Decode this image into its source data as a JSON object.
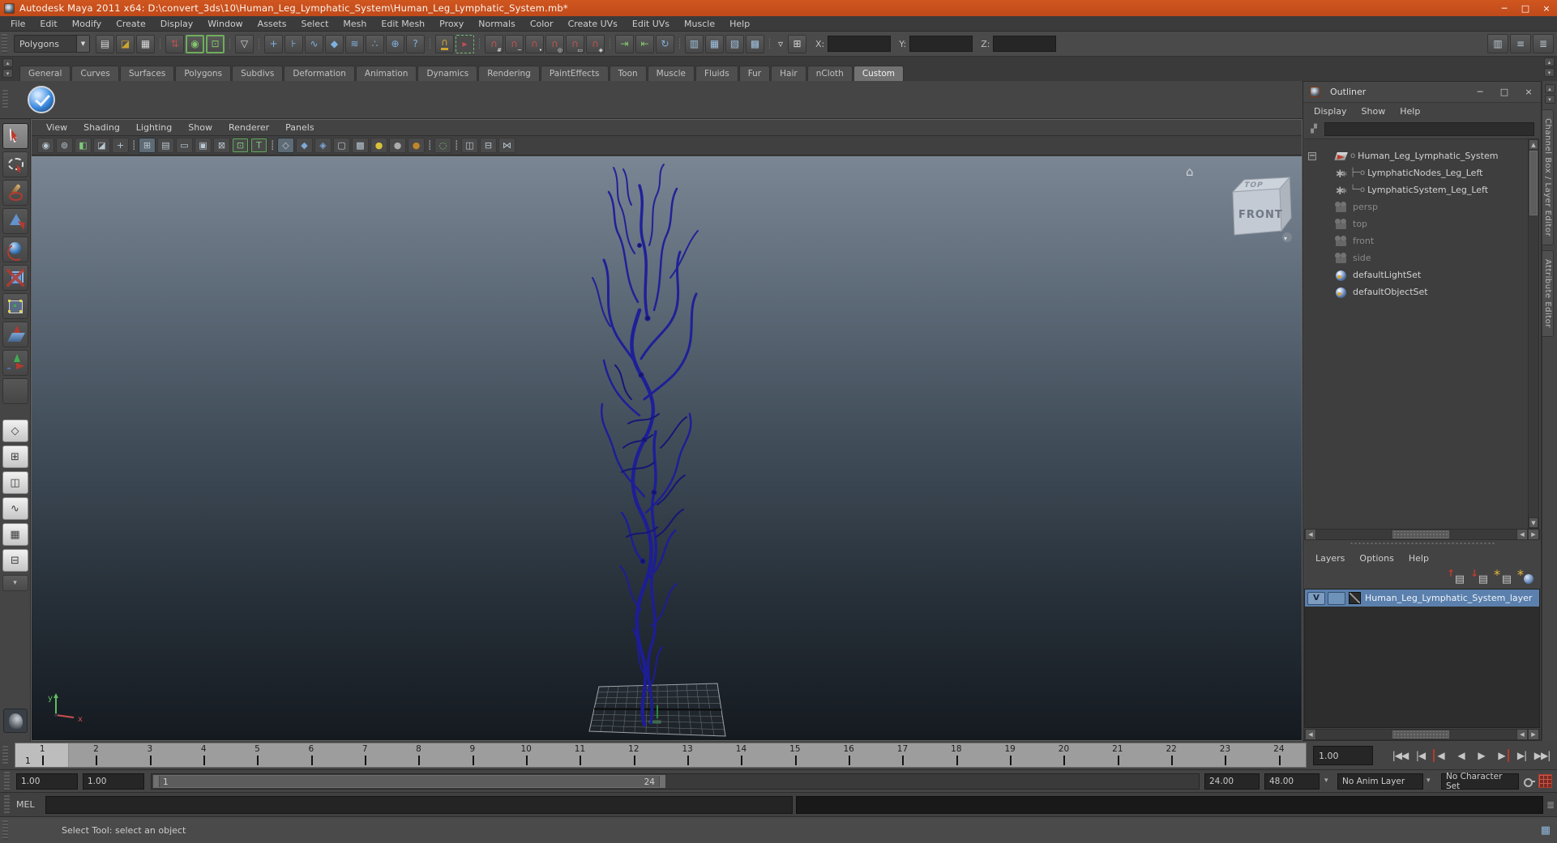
{
  "window": {
    "title": "Autodesk Maya 2011 x64: D:\\convert_3ds\\10\\Human_Leg_Lymphatic_System\\Human_Leg_Lymphatic_System.mb*",
    "buttons": [
      {
        "n": "window-minimize-button",
        "g": "─"
      },
      {
        "n": "window-maximize-button",
        "g": "□"
      },
      {
        "n": "window-close-button",
        "g": "×"
      }
    ]
  },
  "menu_bar": {
    "items": [
      "File",
      "Edit",
      "Modify",
      "Create",
      "Display",
      "Window",
      "Assets",
      "Select",
      "Mesh",
      "Edit Mesh",
      "Proxy",
      "Normals",
      "Color",
      "Create UVs",
      "Edit UVs",
      "Muscle",
      "Help"
    ]
  },
  "status_line": {
    "mode": "Polygons",
    "caret": "▼",
    "icons": [
      {
        "n": "new-scene-icon",
        "g": "▤",
        "cls": "cw"
      },
      {
        "n": "open-scene-icon",
        "g": "◪",
        "cls": "cgold"
      },
      {
        "n": "save-scene-icon",
        "g": "▦",
        "cls": "cw"
      },
      {
        "n": "separator",
        "g": "┊",
        "cls": "sep"
      },
      {
        "n": "select-by-hierarchy-icon",
        "g": "⇅",
        "cls": "cred"
      },
      {
        "n": "select-by-object-icon",
        "g": "◉",
        "cls": "cgreen on"
      },
      {
        "n": "select-by-component-icon",
        "g": "⊡",
        "cls": "cgreen on"
      },
      {
        "n": "separator",
        "g": "┊",
        "cls": "sep"
      },
      {
        "n": "selection-mask-menu-icon",
        "g": "▽",
        "cls": "cw"
      },
      {
        "n": "separator",
        "g": "┊",
        "cls": "sep"
      },
      {
        "n": "select-handles-mask-icon",
        "g": "+",
        "cls": "cblue"
      },
      {
        "n": "select-joints-mask-icon",
        "g": "⊦",
        "cls": "cblue"
      },
      {
        "n": "select-curves-mask-icon",
        "g": "∿",
        "cls": "cblue"
      },
      {
        "n": "select-surfaces-mask-icon",
        "g": "◆",
        "cls": "cblue"
      },
      {
        "n": "select-deformations-mask-icon",
        "g": "≋",
        "cls": "cblue"
      },
      {
        "n": "select-dynamics-mask-icon",
        "g": "∴",
        "cls": "cblue"
      },
      {
        "n": "select-rendering-mask-icon",
        "g": "⊕",
        "cls": "cblue"
      },
      {
        "n": "select-misc-mask-icon",
        "g": "?",
        "cls": "cblue"
      },
      {
        "n": "separator",
        "g": "┊",
        "cls": "sep"
      },
      {
        "n": "lock-selection-icon",
        "g": "∩",
        "cls": "cgold lock"
      },
      {
        "n": "highlight-selection-mode-icon",
        "g": "▸",
        "cls": "cred dashg"
      },
      {
        "n": "separator",
        "g": "┊",
        "cls": "sep"
      },
      {
        "n": "snap-to-grids-icon",
        "g": "∩",
        "cls": "cred",
        "sub": "#"
      },
      {
        "n": "snap-to-curves-icon",
        "g": "∩",
        "cls": "cred",
        "sub": "~"
      },
      {
        "n": "snap-to-points-icon",
        "g": "∩",
        "cls": "cred",
        "sub": "•"
      },
      {
        "n": "snap-to-projected-center-icon",
        "g": "∩",
        "cls": "cred",
        "sub": "◎"
      },
      {
        "n": "snap-to-view-planes-icon",
        "g": "∩",
        "cls": "cred",
        "sub": "▭"
      },
      {
        "n": "make-object-live-icon",
        "g": "∩",
        "cls": "cred",
        "sub": "◈"
      },
      {
        "n": "separator",
        "g": "┊",
        "cls": "sep"
      },
      {
        "n": "input-connections-icon",
        "g": "⇥",
        "cls": "cgreen"
      },
      {
        "n": "output-connections-icon",
        "g": "⇤",
        "cls": "cgreen"
      },
      {
        "n": "construction-history-icon",
        "g": "↻",
        "cls": "cblue"
      },
      {
        "n": "separator",
        "g": "┊",
        "cls": "sep"
      },
      {
        "n": "render-view-icon",
        "g": "▥",
        "cls": "crnd"
      },
      {
        "n": "render-current-frame-icon",
        "g": "▦",
        "cls": "crnd"
      },
      {
        "n": "ipr-render-icon",
        "g": "▧",
        "cls": "crnd"
      },
      {
        "n": "render-settings-icon",
        "g": "▩",
        "cls": "crnd"
      },
      {
        "n": "separator",
        "g": "┊",
        "cls": "sep"
      },
      {
        "n": "transform-entry-caret-icon",
        "g": "▿",
        "cls": "cw plain"
      },
      {
        "n": "absolute-transform-icon",
        "g": "⊞",
        "cls": "cw"
      }
    ],
    "coord": {
      "x_label": "X:",
      "y_label": "Y:",
      "z_label": "Z:"
    },
    "right_icons": [
      {
        "n": "show-modeling-toolkit-icon",
        "g": "▥",
        "cls": "cg"
      },
      {
        "n": "show-channel-box-icon",
        "g": "≡",
        "cls": "cg"
      },
      {
        "n": "show-attribute-editor-icon",
        "g": "≣",
        "cls": "cg"
      }
    ]
  },
  "shelf": {
    "left_icons": [
      {
        "n": "shelf-tab-cycle-up-icon",
        "g": "▴"
      },
      {
        "n": "shelf-tab-cycle-down-icon",
        "g": "▾"
      }
    ],
    "right_icons": [
      {
        "n": "shelf-menu-up-icon",
        "g": "▴"
      },
      {
        "n": "shelf-menu-down-icon",
        "g": "▾"
      }
    ],
    "tabs": [
      {
        "label": "General",
        "cls": ""
      },
      {
        "label": "Curves",
        "cls": ""
      },
      {
        "label": "Surfaces",
        "cls": ""
      },
      {
        "label": "Polygons",
        "cls": ""
      },
      {
        "label": "Subdivs",
        "cls": ""
      },
      {
        "label": "Deformation",
        "cls": ""
      },
      {
        "label": "Animation",
        "cls": ""
      },
      {
        "label": "Dynamics",
        "cls": ""
      },
      {
        "label": "Rendering",
        "cls": ""
      },
      {
        "label": "PaintEffects",
        "cls": ""
      },
      {
        "label": "Toon",
        "cls": ""
      },
      {
        "label": "Muscle",
        "cls": ""
      },
      {
        "label": "Fluids",
        "cls": ""
      },
      {
        "label": "Fur",
        "cls": ""
      },
      {
        "label": "Hair",
        "cls": ""
      },
      {
        "label": "nCloth",
        "cls": ""
      },
      {
        "label": "Custom",
        "cls": "active"
      }
    ]
  },
  "toolbox": {
    "tools": [
      {
        "n": "select-tool",
        "cls": "active",
        "icon": "t-select"
      },
      {
        "n": "lasso-select-tool",
        "cls": "",
        "icon": "t-lasso"
      },
      {
        "n": "paint-select-tool",
        "cls": "",
        "icon": "t-paint"
      },
      {
        "n": "move-tool",
        "cls": "",
        "icon": "t-move"
      },
      {
        "n": "rotate-tool",
        "cls": "",
        "icon": "t-rotate"
      },
      {
        "n": "scale-tool",
        "cls": "",
        "icon": "t-scale"
      },
      {
        "n": "universal-manipulator-tool",
        "cls": "",
        "icon": "t-universal"
      },
      {
        "n": "soft-modification-tool",
        "cls": "",
        "icon": "t-softmod"
      },
      {
        "n": "show-manipulator-tool",
        "cls": "",
        "icon": "t-showmanip"
      },
      {
        "n": "last-tool-slot",
        "cls": "",
        "icon": "t-none"
      }
    ],
    "layouts": [
      {
        "n": "single-pane-layout-button",
        "g": "◇",
        "cls": ""
      },
      {
        "n": "four-pane-layout-button",
        "g": "⊞",
        "cls": ""
      },
      {
        "n": "persp-outliner-layout-button",
        "g": "◫",
        "cls": ""
      },
      {
        "n": "persp-graph-layout-button",
        "g": "∿",
        "cls": ""
      },
      {
        "n": "hypershade-persp-layout-button",
        "g": "▦",
        "cls": ""
      },
      {
        "n": "persp-trax-layout-button",
        "g": "⊟",
        "cls": ""
      },
      {
        "n": "layout-shortcuts-menu-button",
        "g": "▾",
        "cls": "dd"
      }
    ]
  },
  "viewport": {
    "menu": [
      "View",
      "Shading",
      "Lighting",
      "Show",
      "Renderer",
      "Panels"
    ],
    "icons": [
      {
        "n": "select-camera-icon",
        "g": "◉",
        "cls": "cg"
      },
      {
        "n": "camera-attributes-icon",
        "g": "⊚",
        "cls": "cg"
      },
      {
        "n": "bookmarks-icon",
        "g": "◧",
        "cls": "cgn"
      },
      {
        "n": "image-plane-icon",
        "g": "◪",
        "cls": "cg"
      },
      {
        "n": "2d-pan-zoom-icon",
        "g": "+",
        "cls": "cg"
      },
      {
        "n": "separator",
        "g": "┊",
        "cls": "sep"
      },
      {
        "n": "grid-toggle-icon",
        "g": "⊞",
        "cls": "cg pressed"
      },
      {
        "n": "film-gate-icon",
        "g": "▤",
        "cls": "cg"
      },
      {
        "n": "resolution-gate-icon",
        "g": "▭",
        "cls": "cg"
      },
      {
        "n": "gate-mask-icon",
        "g": "▣",
        "cls": "cg"
      },
      {
        "n": "field-chart-icon",
        "g": "⊠",
        "cls": "cg"
      },
      {
        "n": "safe-action-icon",
        "g": "⊡",
        "cls": "cgn con"
      },
      {
        "n": "safe-title-icon",
        "g": "T",
        "cls": "cgn con"
      },
      {
        "n": "separator",
        "g": "┊",
        "cls": "sep"
      },
      {
        "n": "wireframe-icon",
        "g": "◇",
        "cls": "cg pressed"
      },
      {
        "n": "smooth-shade-all-icon",
        "g": "◆",
        "cls": "cb"
      },
      {
        "n": "flat-shade-all-icon",
        "g": "◈",
        "cls": "cb"
      },
      {
        "n": "bounding-box-icon",
        "g": "▢",
        "cls": "cg"
      },
      {
        "n": "textured-icon",
        "g": "▩",
        "cls": "cg"
      },
      {
        "n": "lighting-all-icon",
        "g": "●",
        "cls": "cy"
      },
      {
        "n": "lighting-default-icon",
        "g": "●",
        "cls": "cgr"
      },
      {
        "n": "lighting-flat-icon",
        "g": "●",
        "cls": "cgo"
      },
      {
        "n": "separator",
        "g": "┊",
        "cls": "sep"
      },
      {
        "n": "isolate-select-icon",
        "g": "◌",
        "cls": "cgn"
      },
      {
        "n": "separator",
        "g": "┊",
        "cls": "sep"
      },
      {
        "n": "wireframe-on-shaded-icon",
        "g": "◫",
        "cls": "cg"
      },
      {
        "n": "xray-icon",
        "g": "⊟",
        "cls": "cg"
      },
      {
        "n": "xray-joints-icon",
        "g": "⋈",
        "cls": "cg"
      }
    ],
    "viewcube": {
      "front": "FRONT",
      "top": "TOP",
      "home": "⌂",
      "nav": "▾"
    },
    "axis": {
      "x": "x",
      "y": "y"
    }
  },
  "outliner": {
    "title": "Outliner",
    "window_buttons": [
      {
        "n": "outliner-minimize-button",
        "g": "─"
      },
      {
        "n": "outliner-maximize-button",
        "g": "□"
      },
      {
        "n": "outliner-close-button",
        "g": "×"
      }
    ],
    "menu": [
      "Display",
      "Show",
      "Help"
    ],
    "items": [
      {
        "exp": "−",
        "icon": "ic-transform",
        "pre": "o",
        "label": "Human_Leg_Lymphatic_System",
        "cls": ""
      },
      {
        "exp": "",
        "icon": "ic-mesh",
        "pre": "├─o",
        "label": "LymphaticNodes_Leg_Left",
        "cls": ""
      },
      {
        "exp": "",
        "icon": "ic-mesh",
        "pre": "└─o",
        "label": "LymphaticSystem_Leg_Left",
        "cls": ""
      },
      {
        "exp": "",
        "icon": "ic-camera muted-ico",
        "pre": "",
        "label": "persp",
        "cls": "muted"
      },
      {
        "exp": "",
        "icon": "ic-camera muted-ico",
        "pre": "",
        "label": "top",
        "cls": "muted"
      },
      {
        "exp": "",
        "icon": "ic-camera muted-ico",
        "pre": "",
        "label": "front",
        "cls": "muted"
      },
      {
        "exp": "",
        "icon": "ic-camera muted-ico",
        "pre": "",
        "label": "side",
        "cls": "muted"
      },
      {
        "exp": "",
        "icon": "ic-set",
        "pre": "",
        "label": "defaultLightSet",
        "cls": ""
      },
      {
        "exp": "",
        "icon": "ic-set",
        "pre": "",
        "label": "defaultObjectSet",
        "cls": ""
      }
    ]
  },
  "layers_panel": {
    "menu": [
      "Layers",
      "Options",
      "Help"
    ],
    "icons": [
      {
        "n": "move-layer-up-icon",
        "cls": "ly-up"
      },
      {
        "n": "move-layer-down-icon",
        "cls": "ly-down"
      },
      {
        "n": "create-empty-layer-icon",
        "cls": "ly-new"
      },
      {
        "n": "create-layer-assign-icon",
        "cls": "ly-assign"
      }
    ],
    "layer": {
      "v": "V",
      "name": "Human_Leg_Lymphatic_System_layer"
    }
  },
  "side_tabs": [
    {
      "n": "tab-channel-box-layer-editor",
      "label": "Channel Box / Layer Editor"
    },
    {
      "n": "tab-attribute-editor",
      "label": "Attribute Editor"
    }
  ],
  "strip_buttons": [
    {
      "n": "dock-scroll-up-icon",
      "g": "▴"
    },
    {
      "n": "dock-scroll-down-icon",
      "g": "▾"
    }
  ],
  "time_slider": {
    "frames": [
      "1",
      "2",
      "3",
      "4",
      "5",
      "6",
      "7",
      "8",
      "9",
      "10",
      "11",
      "12",
      "13",
      "14",
      "15",
      "16",
      "17",
      "18",
      "19",
      "20",
      "21",
      "22",
      "23",
      "24"
    ],
    "current_frame": "1",
    "current_time": "1.00",
    "playback": [
      {
        "n": "go-to-start-button",
        "g": "|◀◀",
        "cls": ""
      },
      {
        "n": "step-back-frame-button",
        "g": "|◀",
        "cls": ""
      },
      {
        "n": "step-back-key-button",
        "g": "◀",
        "cls": "redl"
      },
      {
        "n": "play-backwards-button",
        "g": "◀",
        "cls": ""
      },
      {
        "n": "play-forward-button",
        "g": "▶",
        "cls": ""
      },
      {
        "n": "step-forward-key-button",
        "g": "▶",
        "cls": "redr"
      },
      {
        "n": "step-forward-frame-button",
        "g": "▶|",
        "cls": ""
      },
      {
        "n": "go-to-end-button",
        "g": "▶▶|",
        "cls": ""
      }
    ]
  },
  "range_slider": {
    "anim_start": "1.00",
    "playback_start": "1.00",
    "bar_start": "1",
    "bar_end": "24",
    "playback_end": "24.00",
    "anim_end": "48.00",
    "caret": "▾",
    "anim_layer": "No Anim Layer",
    "character_set": "No Character Set"
  },
  "command_line": {
    "label": "MEL",
    "panel_icon": "≣"
  },
  "help_line": {
    "message": "Select Tool: select an object",
    "corner_icon": "▦"
  }
}
